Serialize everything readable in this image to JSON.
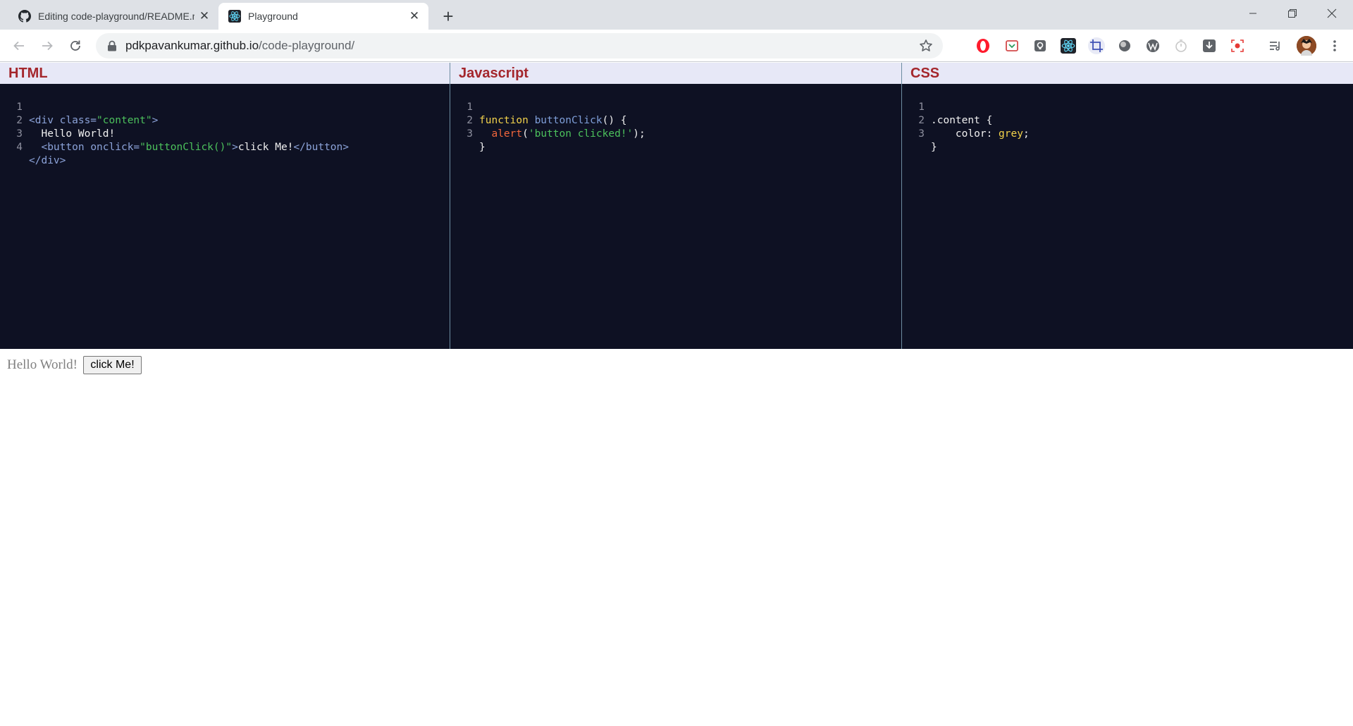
{
  "browser": {
    "tabs": [
      {
        "title": "Editing code-playground/README.md",
        "icon": "github-icon",
        "active": false
      },
      {
        "title": "Playground",
        "icon": "react-icon",
        "active": true
      }
    ],
    "new_tab": "+",
    "address": {
      "host": "pdkpavankumar.github.io",
      "path": "/code-playground/"
    },
    "extensions": [
      "opera-icon",
      "pocket-icon",
      "keep-icon",
      "react-devtools-icon",
      "crop-icon",
      "dark-circle-icon",
      "wordpress-icon",
      "timer-icon",
      "download-icon",
      "screen-record-icon",
      "reading-list-icon",
      "profile-avatar"
    ]
  },
  "editors": {
    "html": {
      "title": "HTML"
    },
    "js": {
      "title": "Javascript"
    },
    "css": {
      "title": "CSS"
    }
  },
  "line_numbers": {
    "n1": "1",
    "n2": "2",
    "n3": "3",
    "n4": "4"
  },
  "code_html": {
    "l1_open": "<div ",
    "l1_attr": "class=",
    "l1_val": "\"content\"",
    "l1_close": ">",
    "l2_text": "  Hello World!",
    "l3_open": "  <button ",
    "l3_attr": "onclick=",
    "l3_val": "\"buttonClick()\"",
    "l3_close": ">",
    "l3_text": "click Me!",
    "l3_end": "</button>",
    "l4_end": "</div>"
  },
  "code_js": {
    "l1_kw": "function ",
    "l1_fn": "buttonClick",
    "l1_rest": "() {",
    "l2_indent": "  ",
    "l2_call": "alert",
    "l2_p1": "(",
    "l2_str": "'button clicked!'",
    "l2_p2": ");",
    "l3": "}"
  },
  "code_css": {
    "l1": ".content {",
    "l2_prop": "    color: ",
    "l2_val": "grey",
    "l2_semi": ";",
    "l3": "}"
  },
  "output": {
    "text": "Hello World!",
    "button_label": "click Me!"
  },
  "colors": {
    "header_text": "#a4262c",
    "header_bg": "#e7e8f7",
    "editor_bg": "#0e1123",
    "tag": "#8ca3d9",
    "string": "#4cc15c",
    "keyword": "#f2d24b",
    "call": "#f2663c",
    "output_text": "#808080"
  }
}
